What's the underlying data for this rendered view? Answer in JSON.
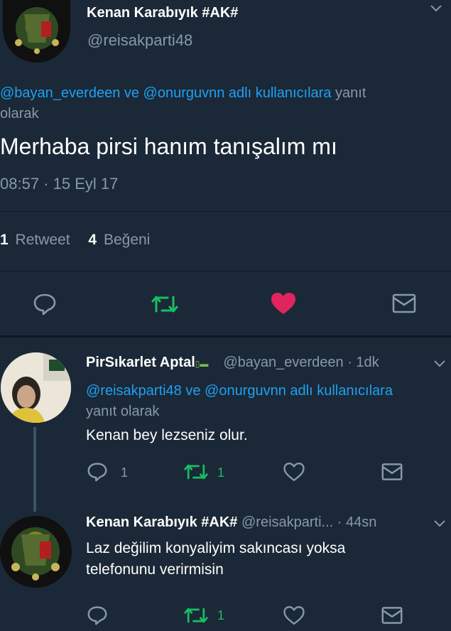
{
  "main_tweet": {
    "display_name": "Kenan Karabıyık #AK#",
    "handle": "@reisakparti48",
    "reply_to_users": "@bayan_everdeen ve @onurguvnn adlı kullanıcılara",
    "reply_to_suffix": "yanıt",
    "reply_to_suffix2": "olarak",
    "text": "Merhaba pirsi hanım tanışalım mı",
    "timestamp": "08:57 · 15 Eyl 17",
    "retweet_count": "1",
    "retweet_label": "Retweet",
    "like_count": "4",
    "like_label": "Beğeni"
  },
  "replies": [
    {
      "display_name": "PirSıkarlet Aptal",
      "handle": "@bayan_everdeen",
      "time": "· 1dk",
      "reply_to_users": "@reisakparti48 ve @onurguvnn adlı kullanıcılara",
      "reply_to_suffix": "yanıt olarak",
      "text": "Kenan bey lezseniz olur.",
      "reply_count": "1",
      "retweet_count": "1"
    },
    {
      "display_name": "Kenan Karabıyık #AK#",
      "handle": "@reisakparti...",
      "time": "· 44sn",
      "text_line1": "Laz değilim konyaliyim sakıncası yoksa",
      "text_line2": "telefonunu verirmisin",
      "retweet_count": "1"
    }
  ],
  "colors": {
    "background": "#1b2837",
    "accent": "#1da1f2",
    "muted": "#8899a6",
    "retweet": "#17bf63",
    "like": "#e0245e"
  },
  "icons": {
    "reply": "reply-icon",
    "retweet": "retweet-icon",
    "like": "heart-icon",
    "dm": "envelope-icon",
    "more": "chevron-down-icon"
  }
}
